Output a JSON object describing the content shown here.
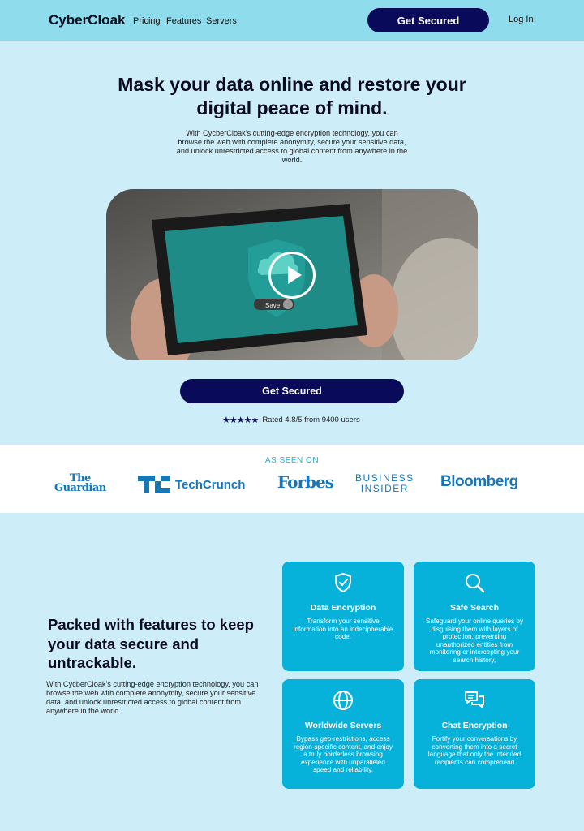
{
  "nav": {
    "logo": "CyberCloak",
    "links": [
      "Pricing",
      "Features",
      "Servers"
    ],
    "cta": "Get Secured",
    "login": "Log In"
  },
  "hero": {
    "title": "Mask your data online and restore your digital peace of mind.",
    "subtitle": "With CycberCloak's cutting-edge encryption technology, you can browse the web with complete anonymity, secure your sensitive data, and unlock unrestricted access to global content from anywhere in the world.",
    "video": {
      "screen_button": "Save",
      "play_icon": "play-icon"
    },
    "cta": "Get Secured",
    "rating_text": "Rated 4.8/5 from 9400 users",
    "rating_stars": 5
  },
  "press": {
    "label": "AS SEEN ON",
    "logos": [
      {
        "name": "the-guardian-logo",
        "line1": "The",
        "line2": "Guardian"
      },
      {
        "name": "techcrunch-logo",
        "text": "TechCrunch"
      },
      {
        "name": "forbes-logo",
        "text": "Forbes"
      },
      {
        "name": "business-insider-logo",
        "line1": "BUSINESS",
        "line2": "INSIDER"
      },
      {
        "name": "bloomberg-logo",
        "text": "Bloomberg"
      }
    ]
  },
  "features": {
    "title": "Packed with features to keep your data secure and untrackable.",
    "description": "With CycberCloak's cutting-edge encryption technology, you can browse the web with complete anonymity, secure your sensitive data, and unlock unrestricted access to global content from anywhere in the world.",
    "cards": [
      {
        "icon": "shield-check-icon",
        "title": "Data Encryption",
        "text": "Transform your sensitive information into an indecipherable code."
      },
      {
        "icon": "search-icon",
        "title": "Safe Search",
        "text": "Safeguard your online queries by disguising them with layers of protection, preventing unauthorized entities from monitoring or intercepting your search history,"
      },
      {
        "icon": "globe-icon",
        "title": "Worldwide Servers",
        "text": "Bypass geo-restrictions, access region-specific content, and enjoy a truly borderless browsing experience with unparalleled speed and reliability."
      },
      {
        "icon": "chat-icon",
        "title": "Chat Encryption",
        "text": "Fortify your conversations by converting them into a secret language that only the intended recipients can comprehend"
      }
    ]
  },
  "colors": {
    "nav_bg": "#8fdcec",
    "page_bg": "#cdeef9",
    "primary_dark": "#0a0a5a",
    "card_bg": "#06b2d9",
    "press_logo": "#1576b8",
    "accent_text": "#1db0d8"
  }
}
